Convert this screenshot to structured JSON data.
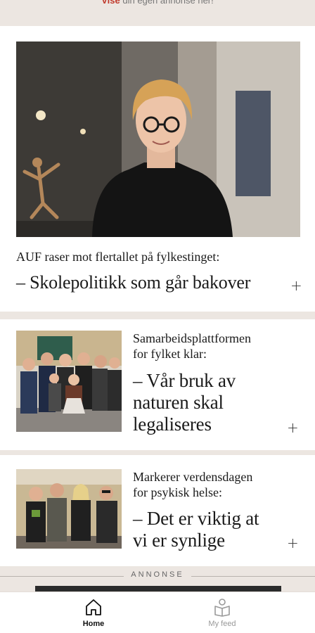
{
  "top_banner": {
    "accent": "Vise",
    "rest": " din egen annonse her!"
  },
  "articles": [
    {
      "kicker": "AUF raser mot flertallet på fylkestinget:",
      "title": "– Skolepolitikk som går bakover"
    },
    {
      "kicker": "Samarbeidsplattformen for fylket klar:",
      "kicker_lines": [
        "Samarbeidsplattformen",
        "for fylket klar:"
      ],
      "title_lines": [
        "– Vår bruk av",
        "naturen skal",
        "legaliseres"
      ]
    },
    {
      "kicker_lines": [
        "Markerer verdensdagen",
        "for psykisk helse:"
      ],
      "title_lines": [
        "– Det er viktig at",
        "vi er synlige"
      ]
    }
  ],
  "ad": {
    "label": "ANNONSE"
  },
  "nav": {
    "home": "Home",
    "feed": "My feed"
  },
  "colors": {
    "accent": "#c0392b",
    "background": "#ece6e1"
  }
}
